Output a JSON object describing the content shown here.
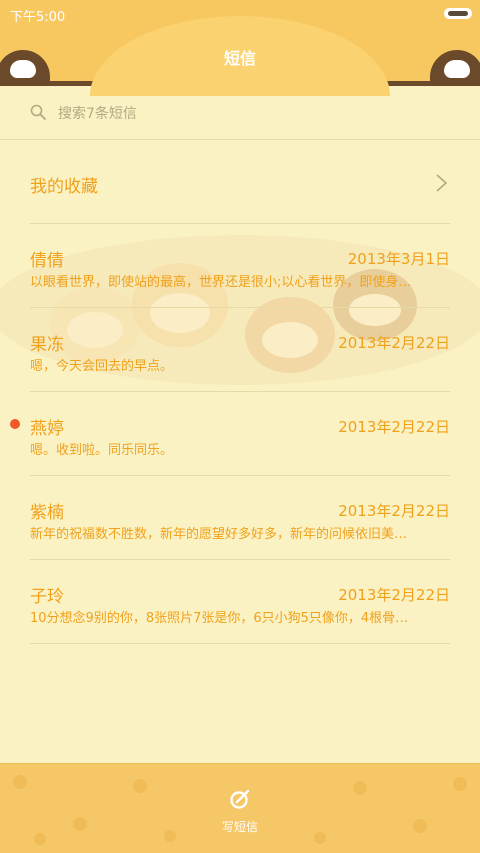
{
  "status_bar": {
    "time": "下午5:00"
  },
  "header": {
    "title": "短信"
  },
  "search": {
    "placeholder": "搜索7条短信"
  },
  "favorites": {
    "label": "我的收藏"
  },
  "conversations": [
    {
      "name": "倩倩",
      "date": "2013年3月1日",
      "preview": "以眼看世界，即使站的最高，世界还是很小;以心看世界，即使身…",
      "unread": false
    },
    {
      "name": "果冻",
      "date": "2013年2月22日",
      "preview": "嗯，今天会回去的早点。",
      "unread": false
    },
    {
      "name": "燕婷",
      "date": "2013年2月22日",
      "preview": "嗯。收到啦。同乐同乐。",
      "unread": true
    },
    {
      "name": "紫楠",
      "date": "2013年2月22日",
      "preview": "新年的祝福数不胜数，新年的愿望好多好多，新年的问候依旧美…",
      "unread": false
    },
    {
      "name": "子玲",
      "date": "2013年2月22日",
      "preview": "10分想念9别的你，8张照片7张是你，6只小狗5只像你，4根骨…",
      "unread": false
    }
  ],
  "bottom_bar": {
    "compose_label": "写短信"
  },
  "colors": {
    "accent": "#f0a11c",
    "header": "#f7c760",
    "background": "#fbf2c4",
    "unread": "#f05a28",
    "brown": "#6b4a2b"
  },
  "icons": {
    "search": "search-icon",
    "chevron": "chevron-right-icon",
    "compose": "compose-icon",
    "battery": "battery-icon"
  }
}
